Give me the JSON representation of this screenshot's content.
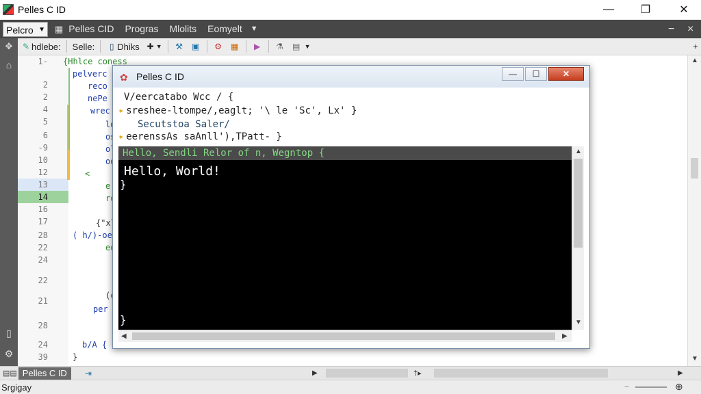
{
  "window": {
    "title": "Pelles C ID",
    "min": "—",
    "max": "❐",
    "close": "✕"
  },
  "menubar": {
    "project": "Pelcro",
    "items": [
      "Pelles CID",
      "Progras",
      "Mlolits",
      "Eomyelt"
    ],
    "min_label": "−",
    "close_label": "×"
  },
  "toolbar": {
    "items": [
      "hdlebe:",
      "Selle:",
      "Dhiks"
    ]
  },
  "editor": {
    "line_numbers": [
      "1-",
      "2",
      "2",
      "4",
      "5",
      "6",
      "-9",
      "10",
      "12",
      "13",
      "14",
      "16",
      "17",
      "28",
      "22",
      "24",
      "22",
      "21",
      "28",
      "24",
      "39"
    ],
    "code": {
      "l1": "{Hhlce coness",
      "l2": "pelverc",
      "l3": "reco",
      "l4": "nePe",
      "l5": "wrec",
      "l6": "lo",
      "l7": "os",
      "l8": "ol",
      "l9": "oo",
      "l10": "<",
      "l11": "e",
      "l12": "ro",
      "l13": "te",
      "l14": "{\"xls",
      "l15": "( h/)-oe",
      "l16": "eo",
      "l17": "(c",
      "l18": "per",
      "l19": "b/A  {",
      "l20": "}"
    }
  },
  "dialog": {
    "title": "Pelles C ID",
    "min": "—",
    "max": "☐",
    "close": "✕",
    "line1": "V/eercatabo Wcc /  {",
    "line2": "sreshee-ltompe/,eaglt; '\\ le 'Sc', Lx' }",
    "line3": "Secutstoa Saler/",
    "line4": "eerenssAs saAnll'),TPatt- }",
    "console_header": "Hello, Sendli Relor of   n, Wegntop  {",
    "console_output": "Hello, World!",
    "brace_open": "}",
    "brace_close": "}"
  },
  "bottom": {
    "tab": "Pelles C ID"
  },
  "status": {
    "text": "Srgigay"
  }
}
